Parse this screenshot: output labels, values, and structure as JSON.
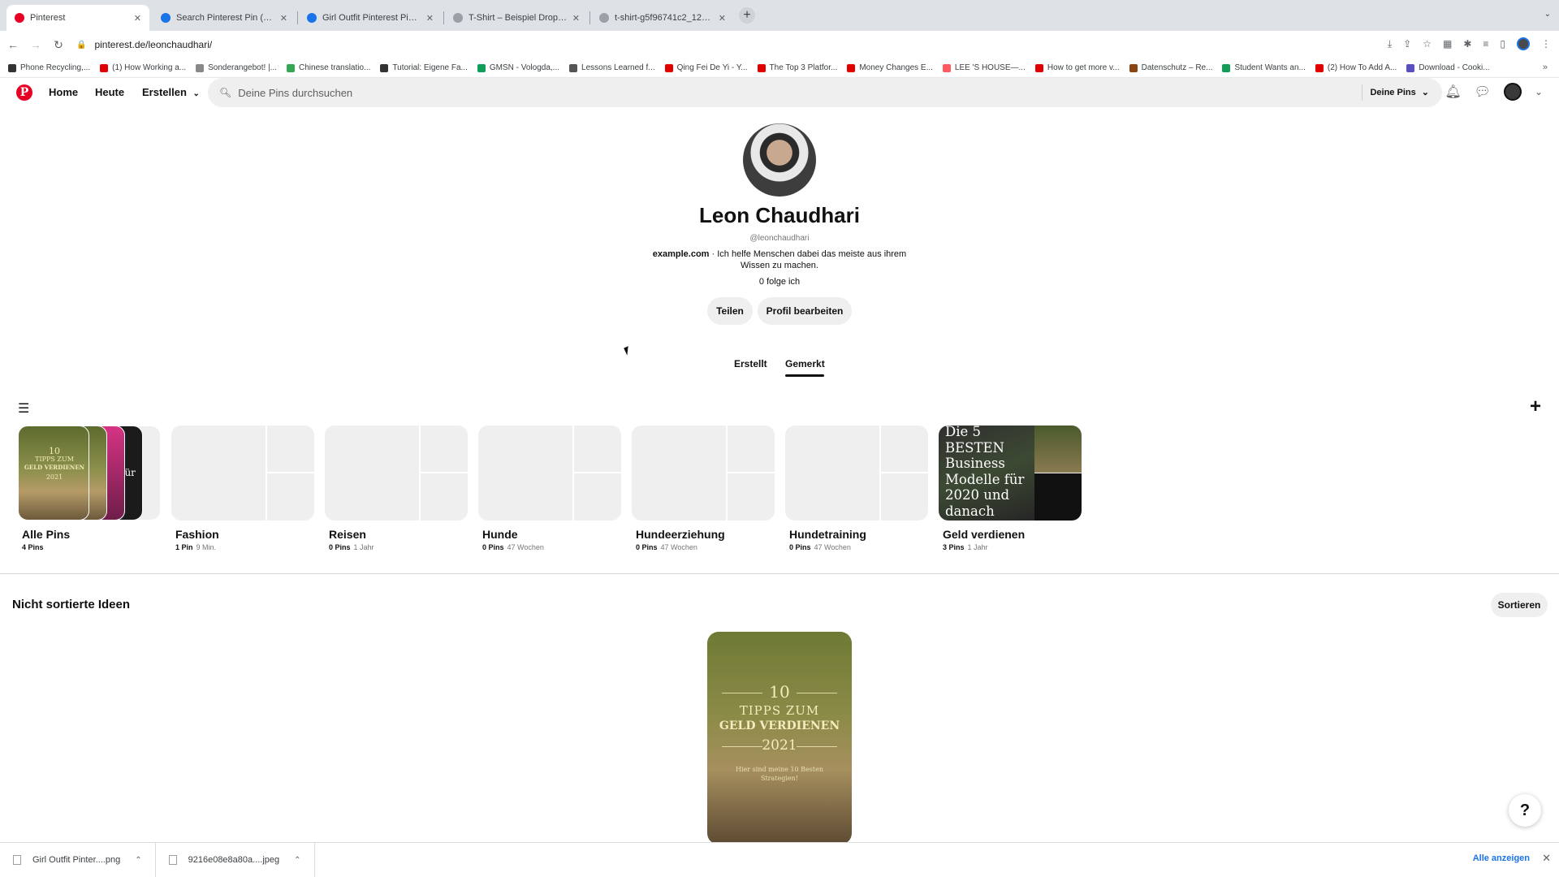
{
  "browser": {
    "tabs": [
      {
        "title": "Pinterest",
        "active": true,
        "color": "#e60023"
      },
      {
        "title": "Search Pinterest Pin (1000 × 15",
        "color": "#1a73e8"
      },
      {
        "title": "Girl Outfit Pinterest Pin (1000 ×",
        "color": "#1a73e8"
      },
      {
        "title": "T-Shirt – Beispiel Dropshipping",
        "color": "#5f6368"
      },
      {
        "title": "t-shirt-g5f96741c2_1280.jpg (",
        "color": "#5f6368"
      }
    ],
    "close_glyph": "✕",
    "new_tab_glyph": "+",
    "url": "pinterest.de/leonchaudhari/",
    "bookmarks": [
      {
        "label": "Phone Recycling,...",
        "color": "#333333"
      },
      {
        "label": "(1) How Working a...",
        "color": "#e00000"
      },
      {
        "label": "Sonderangebot! |...",
        "color": "#888888"
      },
      {
        "label": "Chinese translatio...",
        "color": "#34a853"
      },
      {
        "label": "Tutorial: Eigene Fa...",
        "color": "#333333"
      },
      {
        "label": "GMSN - Vologda,...",
        "color": "#0f9d58"
      },
      {
        "label": "Lessons Learned f...",
        "color": "#555555"
      },
      {
        "label": "Qing Fei De Yi - Y...",
        "color": "#e00000"
      },
      {
        "label": "The Top 3 Platfor...",
        "color": "#e00000"
      },
      {
        "label": "Money Changes E...",
        "color": "#e00000"
      },
      {
        "label": "LEE 'S HOUSE—...",
        "color": "#ff5a5f"
      },
      {
        "label": "How to get more v...",
        "color": "#e00000"
      },
      {
        "label": "Datenschutz – Re...",
        "color": "#8b4513"
      },
      {
        "label": "Student Wants an...",
        "color": "#0f9d58"
      },
      {
        "label": "(2) How To Add A...",
        "color": "#e00000"
      },
      {
        "label": "Download - Cooki...",
        "color": "#5b4fbf"
      }
    ],
    "bookmarks_more": "»"
  },
  "header": {
    "logo_letter": "P",
    "nav": [
      "Home",
      "Heute",
      "Erstellen"
    ],
    "search_placeholder": "Deine Pins durchsuchen",
    "search_scope": "Deine Pins"
  },
  "profile": {
    "name": "Leon Chaudhari",
    "handle": "@leonchaudhari",
    "website": "example.com",
    "bio": " · Ich helfe Menschen dabei das meiste aus ihrem Wissen zu machen.",
    "following": "0 folge ich",
    "share_label": "Teilen",
    "edit_label": "Profil bearbeiten",
    "tabs": [
      "Erstellt",
      "Gemerkt"
    ]
  },
  "boards": [
    {
      "title": "Alle Pins",
      "pins": "4 Pins",
      "age": ""
    },
    {
      "title": "Fashion",
      "pins": "1 Pin",
      "age": "9 Min."
    },
    {
      "title": "Reisen",
      "pins": "0 Pins",
      "age": "1 Jahr"
    },
    {
      "title": "Hunde",
      "pins": "0 Pins",
      "age": "47 Wochen"
    },
    {
      "title": "Hundeerziehung",
      "pins": "0 Pins",
      "age": "47 Wochen"
    },
    {
      "title": "Hundetraining",
      "pins": "0 Pins",
      "age": "47 Wochen"
    },
    {
      "title": "Geld verdienen",
      "pins": "3 Pins",
      "age": "1 Jahr"
    }
  ],
  "pin_art": {
    "tips_number": "10",
    "tips_line": "TIPPS ZUM",
    "tips_line2": "GELD VERDIENEN",
    "tips_year": "2021",
    "tips_sub": "Hier sind meine 10 Besten Strategien!",
    "stack_fuer": "für",
    "geld_cover_text": "Die 5 BESTEN Business Modelle für 2020 und danach"
  },
  "section": {
    "title": "Nicht sortierte Ideen",
    "sort_label": "Sortieren"
  },
  "help_label": "?",
  "downloads": {
    "items": [
      "Girl Outfit Pinter....png",
      "9216e08e8a80a....jpeg"
    ],
    "show_all": "Alle anzeigen"
  }
}
